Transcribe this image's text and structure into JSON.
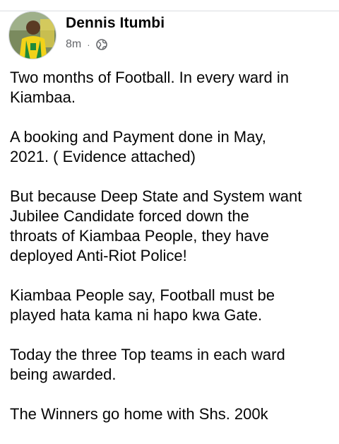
{
  "post": {
    "author": "Dennis Itumbi",
    "time": "8m",
    "separator": "·",
    "audience_icon": "globe-icon",
    "avatar_icon": "profile-photo",
    "paragraphs": [
      "Two months of Football. In every ward in\nKiambaa.",
      "A booking and Payment done in May,\n2021. ( Evidence attached)",
      "But because Deep State and System want\nJubilee Candidate forced down the\nthroats of Kiambaa People, they have\ndeployed Anti-Riot Police!",
      "Kiambaa People say, Football must be\nplayed hata kama ni hapo kwa Gate.",
      "Today the three Top teams in each ward\nbeing awarded.",
      "The Winners go home with Shs. 200k"
    ]
  },
  "colors": {
    "text": "#050505",
    "meta": "#65676b",
    "divider": "#dadde1",
    "jersey_yellow": "#f2d21a",
    "jersey_green": "#1f8a3a"
  }
}
